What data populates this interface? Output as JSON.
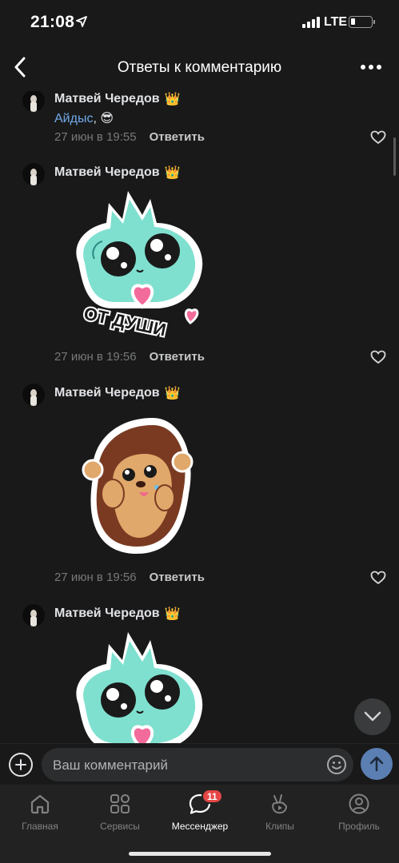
{
  "status_bar": {
    "time": "21:08",
    "network": "LTE"
  },
  "header": {
    "title": "Ответы к комментарию"
  },
  "comments": [
    {
      "author": "Матвей Чередов",
      "badge": "👑",
      "mention": "Айдыс",
      "text_suffix": ", 😎",
      "time": "27 июн в 19:55",
      "reply_label": "Ответить",
      "sticker": null
    },
    {
      "author": "Матвей Чередов",
      "badge": "👑",
      "time": "27 июн в 19:56",
      "reply_label": "Ответить",
      "sticker": "fluffy-creature-heart-sticker",
      "sticker_text": "ОТ ДУШИ"
    },
    {
      "author": "Матвей Чередов",
      "badge": "👑",
      "time": "27 июн в 19:56",
      "reply_label": "Ответить",
      "sticker": "hedgehog-sticker"
    },
    {
      "author": "Матвей Чередов",
      "badge": "👑",
      "sticker": "fluffy-creature-heart-sticker"
    }
  ],
  "composer": {
    "placeholder": "Ваш комментарий"
  },
  "tabbar": {
    "tabs": [
      {
        "label": "Главная",
        "icon": "home-icon"
      },
      {
        "label": "Сервисы",
        "icon": "services-grid-icon"
      },
      {
        "label": "Мессенджер",
        "icon": "messenger-icon",
        "badge": "11",
        "active": true
      },
      {
        "label": "Клипы",
        "icon": "clips-icon"
      },
      {
        "label": "Профиль",
        "icon": "profile-icon"
      }
    ]
  },
  "colors": {
    "background": "#191919",
    "accent_link": "#71aaeb",
    "send_button": "#5b7fb2",
    "badge": "#e64646"
  }
}
